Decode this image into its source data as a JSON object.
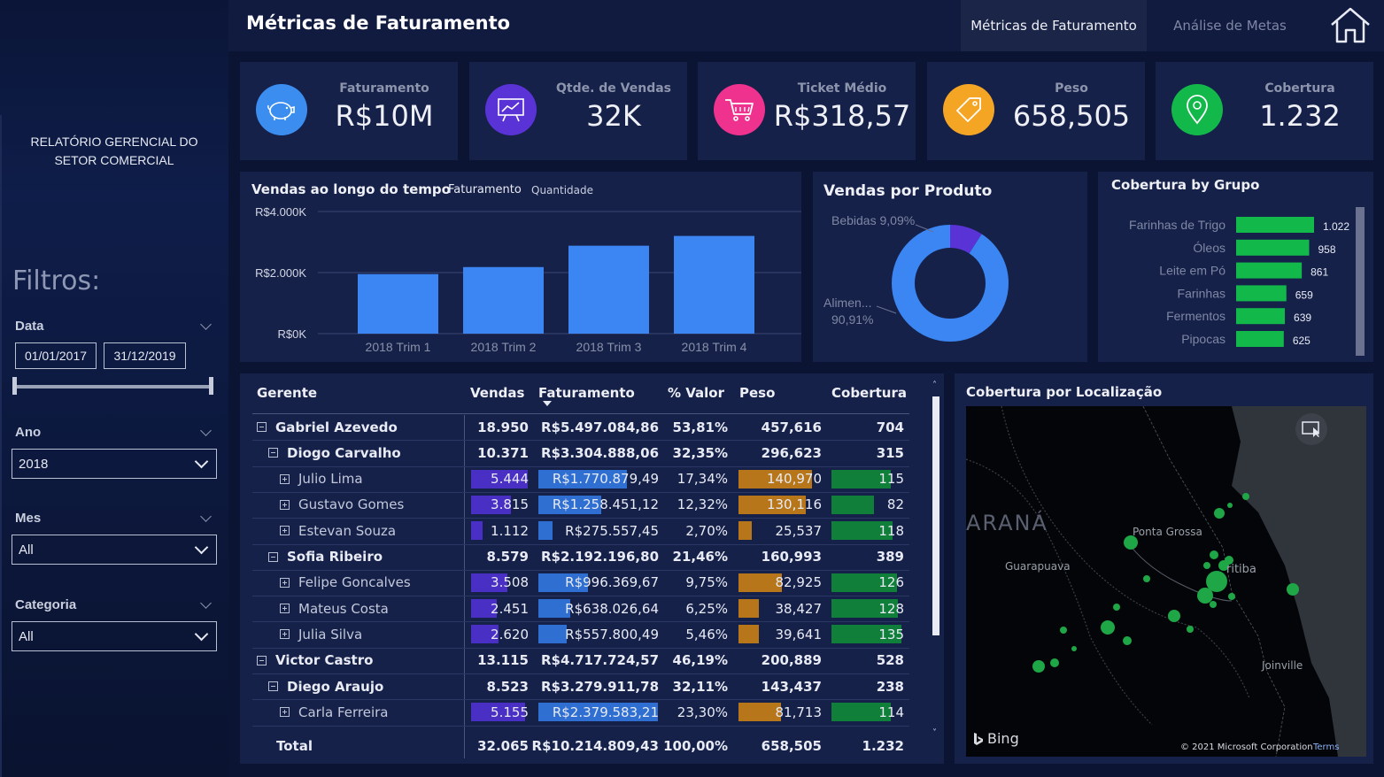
{
  "sidebar": {
    "report_title_line1": "RELATÓRIO GERENCIAL DO",
    "report_title_line2": "SETOR COMERCIAL",
    "filters_title": "Filtros:",
    "data_label": "Data",
    "date_start": "01/01/2017",
    "date_end": "31/12/2019",
    "ano_label": "Ano",
    "ano_value": "2018",
    "mes_label": "Mes",
    "mes_value": "All",
    "categoria_label": "Categoria",
    "categoria_value": "All"
  },
  "header": {
    "title": "Métricas de Faturamento",
    "tab_active": "Métricas de Faturamento",
    "tab_other": "Análise de Metas",
    "home_icon": "home-icon"
  },
  "kpis": [
    {
      "label": "Faturamento",
      "value": "R$10M",
      "icon": "piggy-bank-icon",
      "color": "#3b8ef0"
    },
    {
      "label": "Qtde. de Vendas",
      "value": "32K",
      "icon": "presentation-chart-icon",
      "color": "#5a33d6"
    },
    {
      "label": "Ticket Médio",
      "value": "R$318,57",
      "icon": "shopping-cart-icon",
      "color": "#f0328f"
    },
    {
      "label": "Peso",
      "value": "658,505",
      "icon": "price-tag-icon",
      "color": "#f5a524"
    },
    {
      "label": "Cobertura",
      "value": "1.232",
      "icon": "location-pin-icon",
      "color": "#13b84a"
    }
  ],
  "vendas_tempo": {
    "title": "Vendas ao longo do tempo",
    "toggle_faturamento": "Faturamento",
    "toggle_quantidade": "Quantidade"
  },
  "vendas_produto": {
    "title": "Vendas por Produto"
  },
  "cobertura_grupo": {
    "title": "Cobertura by Grupo"
  },
  "cobertura_local": {
    "title": "Cobertura por Localização",
    "map_labels": {
      "parana": "ARANÁ",
      "ponta_grossa": "Ponta Grossa",
      "guarapuava": "Guarapuava",
      "curitiba": "ritiba",
      "joinville": "Joinville"
    },
    "bing": "Bing",
    "copyright": "© 2021 Microsoft Corporation",
    "terms": "Terms"
  },
  "chart_data": [
    {
      "type": "bar",
      "title": "Vendas ao longo do tempo",
      "categories": [
        "2018 Trim 1",
        "2018 Trim 2",
        "2018 Trim 3",
        "2018 Trim 4"
      ],
      "values": [
        1950000,
        2180000,
        2880000,
        3200000
      ],
      "ytick_labels": [
        "R$4.000K",
        "R$2.000K",
        "R$0K"
      ],
      "yticks": [
        4000000,
        2000000,
        0
      ],
      "ylim": [
        0,
        4000000
      ],
      "color": "#3b86f2",
      "grid": true
    },
    {
      "type": "pie",
      "donut": true,
      "title": "Vendas por Produto",
      "labels": [
        "Bebidas",
        "Alimen..."
      ],
      "percent_labels": [
        "9,09%",
        "90,91%"
      ],
      "values": [
        9.09,
        90.91
      ],
      "colors": [
        "#5a33d6",
        "#3b86f2"
      ]
    },
    {
      "type": "bar",
      "orientation": "horizontal",
      "title": "Cobertura by Grupo",
      "categories": [
        "Farinhas de Trigo",
        "Óleos",
        "Leite em Pó",
        "Farinhas",
        "Fermentos",
        "Pipocas"
      ],
      "values": [
        1022,
        958,
        861,
        659,
        639,
        625
      ],
      "value_labels": [
        "1.022",
        "958",
        "861",
        "659",
        "639",
        "625"
      ],
      "color": "#13b84a"
    },
    {
      "type": "table",
      "columns": [
        "Gerente",
        "Vendas",
        "Faturamento",
        "% Valor",
        "Peso",
        "Cobertura"
      ],
      "rows": [
        {
          "name": "Gabriel Azevedo",
          "level": 0,
          "expander": "minus",
          "bold": true,
          "vendas": "18.950",
          "faturamento": "R$5.497.084,86",
          "pct": "53,81%",
          "peso": "457,616",
          "cobertura": "704"
        },
        {
          "name": "Diogo Carvalho",
          "level": 1,
          "expander": "minus",
          "bold": true,
          "vendas": "10.371",
          "faturamento": "R$3.304.888,06",
          "pct": "32,35%",
          "peso": "296,623",
          "cobertura": "315"
        },
        {
          "name": "Julio Lima",
          "level": 2,
          "expander": "plus",
          "bold": false,
          "vendas": "5.444",
          "faturamento": "R$1.770.879,49",
          "pct": "17,34%",
          "peso": "140,970",
          "cobertura": "115",
          "bars": {
            "vendas": 5444,
            "faturamento": 1770879.49,
            "peso": 140.97,
            "cobertura": 115
          }
        },
        {
          "name": "Gustavo Gomes",
          "level": 2,
          "expander": "plus",
          "bold": false,
          "vendas": "3.815",
          "faturamento": "R$1.258.451,12",
          "pct": "12,32%",
          "peso": "130,116",
          "cobertura": "82",
          "bars": {
            "vendas": 3815,
            "faturamento": 1258451.12,
            "peso": 130.116,
            "cobertura": 82
          }
        },
        {
          "name": "Estevan Souza",
          "level": 2,
          "expander": "plus",
          "bold": false,
          "vendas": "1.112",
          "faturamento": "R$275.557,45",
          "pct": "2,70%",
          "peso": "25,537",
          "cobertura": "118",
          "bars": {
            "vendas": 1112,
            "faturamento": 275557.45,
            "peso": 25.537,
            "cobertura": 118
          }
        },
        {
          "name": "Sofia Ribeiro",
          "level": 1,
          "expander": "minus",
          "bold": true,
          "vendas": "8.579",
          "faturamento": "R$2.192.196,80",
          "pct": "21,46%",
          "peso": "160,993",
          "cobertura": "389"
        },
        {
          "name": "Felipe Goncalves",
          "level": 2,
          "expander": "plus",
          "bold": false,
          "vendas": "3.508",
          "faturamento": "R$996.369,67",
          "pct": "9,75%",
          "peso": "82,925",
          "cobertura": "126",
          "bars": {
            "vendas": 3508,
            "faturamento": 996369.67,
            "peso": 82.925,
            "cobertura": 126
          }
        },
        {
          "name": "Mateus Costa",
          "level": 2,
          "expander": "plus",
          "bold": false,
          "vendas": "2.451",
          "faturamento": "R$638.026,64",
          "pct": "6,25%",
          "peso": "38,427",
          "cobertura": "128",
          "bars": {
            "vendas": 2451,
            "faturamento": 638026.64,
            "peso": 38.427,
            "cobertura": 128
          }
        },
        {
          "name": "Julia Silva",
          "level": 2,
          "expander": "plus",
          "bold": false,
          "vendas": "2.620",
          "faturamento": "R$557.800,49",
          "pct": "5,46%",
          "peso": "39,641",
          "cobertura": "135",
          "bars": {
            "vendas": 2620,
            "faturamento": 557800.49,
            "peso": 39.641,
            "cobertura": 135
          }
        },
        {
          "name": "Victor Castro",
          "level": 0,
          "expander": "minus",
          "bold": true,
          "vendas": "13.115",
          "faturamento": "R$4.717.724,57",
          "pct": "46,19%",
          "peso": "200,889",
          "cobertura": "528"
        },
        {
          "name": "Diego Araujo",
          "level": 1,
          "expander": "minus",
          "bold": true,
          "vendas": "8.523",
          "faturamento": "R$3.279.911,78",
          "pct": "32,11%",
          "peso": "143,437",
          "cobertura": "238"
        },
        {
          "name": "Carla Ferreira",
          "level": 2,
          "expander": "plus",
          "bold": false,
          "vendas": "5.155",
          "faturamento": "R$2.379.583,21",
          "pct": "23,30%",
          "peso": "81,713",
          "cobertura": "114",
          "bars": {
            "vendas": 5155,
            "faturamento": 2379583.21,
            "peso": 81.713,
            "cobertura": 114
          }
        }
      ],
      "total": {
        "name": "Total",
        "vendas": "32.065",
        "faturamento": "R$10.214.809,43",
        "pct": "100,00%",
        "peso": "658,505",
        "cobertura": "1.232"
      },
      "bar_max": {
        "vendas": 5500,
        "faturamento": 2400000,
        "peso": 160,
        "cobertura": 140
      },
      "bar_colors": {
        "vendas": "#4a2fc4",
        "faturamento": "#2f6fd2",
        "peso": "#b7761a",
        "cobertura": "#0f7f3a"
      }
    }
  ]
}
